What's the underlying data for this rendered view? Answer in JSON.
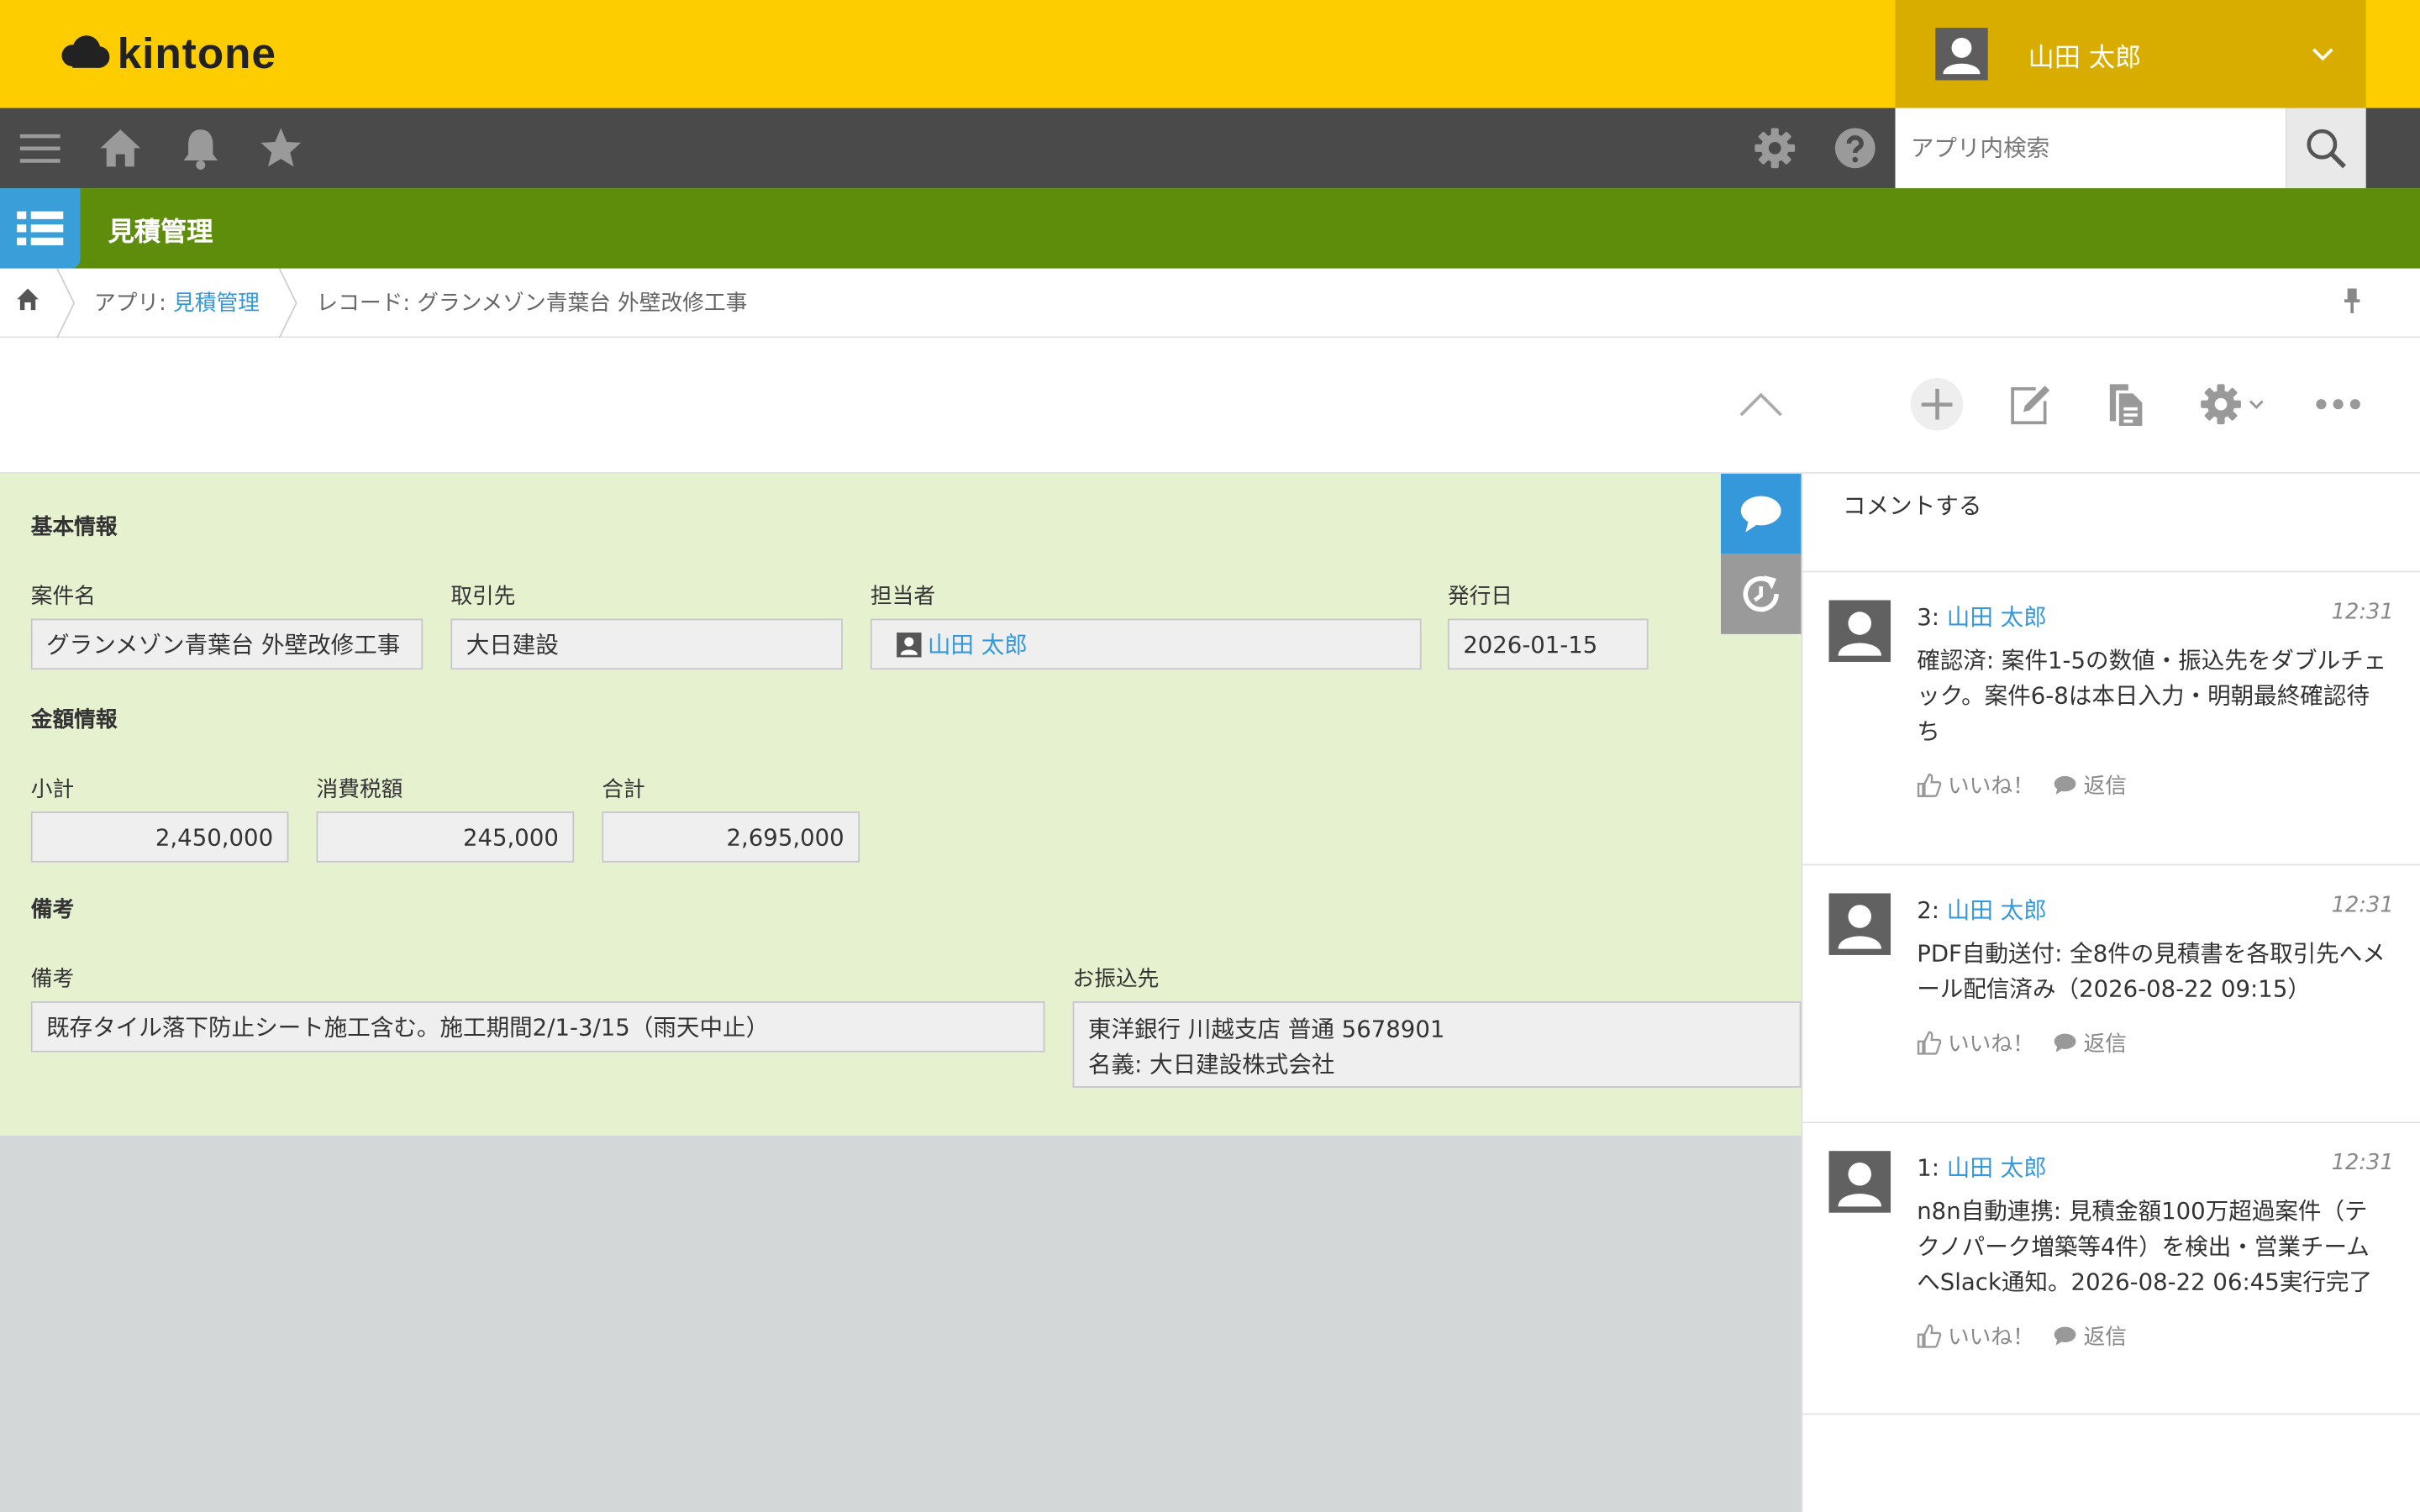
{
  "header": {
    "logo_text": "kintone",
    "user_name": "山田 太郎"
  },
  "toolbar": {
    "search_placeholder": "アプリ内検索"
  },
  "app": {
    "title": "見積管理"
  },
  "breadcrumb": {
    "app_prefix": "アプリ: ",
    "app_link": "見積管理",
    "record": "レコード: グランメゾン青葉台 外壁改修工事"
  },
  "sections": {
    "basic": "基本情報",
    "amount": "金額情報",
    "notes": "備考"
  },
  "fields": {
    "project_name": {
      "label": "案件名",
      "value": "グランメゾン青葉台 外壁改修工事"
    },
    "client": {
      "label": "取引先",
      "value": "大日建設"
    },
    "owner": {
      "label": "担当者",
      "value": "山田 太郎"
    },
    "issue_date": {
      "label": "発行日",
      "value": "2026-01-15"
    },
    "subtotal": {
      "label": "小計",
      "value": "2,450,000"
    },
    "tax": {
      "label": "消費税額",
      "value": "245,000"
    },
    "total": {
      "label": "合計",
      "value": "2,695,000"
    },
    "remarks": {
      "label": "備考",
      "value": "既存タイル落下防止シート施工含む。施工期間2/1-3/15（雨天中止）"
    },
    "bank": {
      "label": "お振込先",
      "line1": "東洋銀行 川越支店 普通 5678901",
      "line2": "名義: 大日建設株式会社"
    }
  },
  "comments": {
    "input_placeholder": "コメントする",
    "like_label": "いいね！",
    "reply_label": "返信",
    "items": [
      {
        "num": "3: ",
        "author": "山田 太郎",
        "time": "12:31",
        "body": "確認済: 案件1-5の数値・振込先をダブルチェック。案件6-8は本日入力・明朝最終確認待ち"
      },
      {
        "num": "2: ",
        "author": "山田 太郎",
        "time": "12:31",
        "body": "PDF自動送付: 全8件の見積書を各取引先へメール配信済み（2026-08-22 09:15）"
      },
      {
        "num": "1: ",
        "author": "山田 太郎",
        "time": "12:31",
        "body": "n8n自動連携: 見積金額100万超過案件（テクノパーク増築等4件）を検出・営業チームへSlack通知。2026-08-22 06:45実行完了"
      }
    ]
  },
  "colors": {
    "header": "#fdcd00",
    "toolbar": "#4a4a4a",
    "appbar": "#5e8d0c",
    "form_bg": "#e6f1d0",
    "link": "#3498db"
  }
}
